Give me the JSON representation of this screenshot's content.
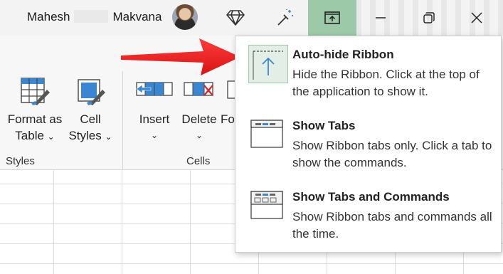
{
  "titlebar": {
    "user_first": "Mahesh",
    "user_last": "Makvana"
  },
  "ribbon": {
    "buttons": [
      {
        "label1": "Format as",
        "label2": "Table"
      },
      {
        "label1": "Cell",
        "label2": "Styles"
      },
      {
        "label1": "Insert",
        "label2": ""
      },
      {
        "label1": "Delete",
        "label2": ""
      },
      {
        "label1": "Fo",
        "label2": ""
      }
    ],
    "chevron": "⌄",
    "groups": {
      "styles": "Styles",
      "cells": "Cells"
    }
  },
  "menu": {
    "items": [
      {
        "title": "Auto-hide Ribbon",
        "desc": "Hide the Ribbon. Click at the top of the application to show it.",
        "icon": "auto-hide-ribbon-icon"
      },
      {
        "title": "Show Tabs",
        "desc": "Show Ribbon tabs only. Click a tab to show the commands.",
        "icon": "show-tabs-icon"
      },
      {
        "title": "Show Tabs and Commands",
        "desc": "Show Ribbon tabs and commands all the time.",
        "icon": "show-tabs-and-commands-icon"
      }
    ]
  },
  "colors": {
    "accent_green": "#9cc9a8",
    "arrow_red": "#e02020",
    "excel_blue": "#3b86d1"
  }
}
